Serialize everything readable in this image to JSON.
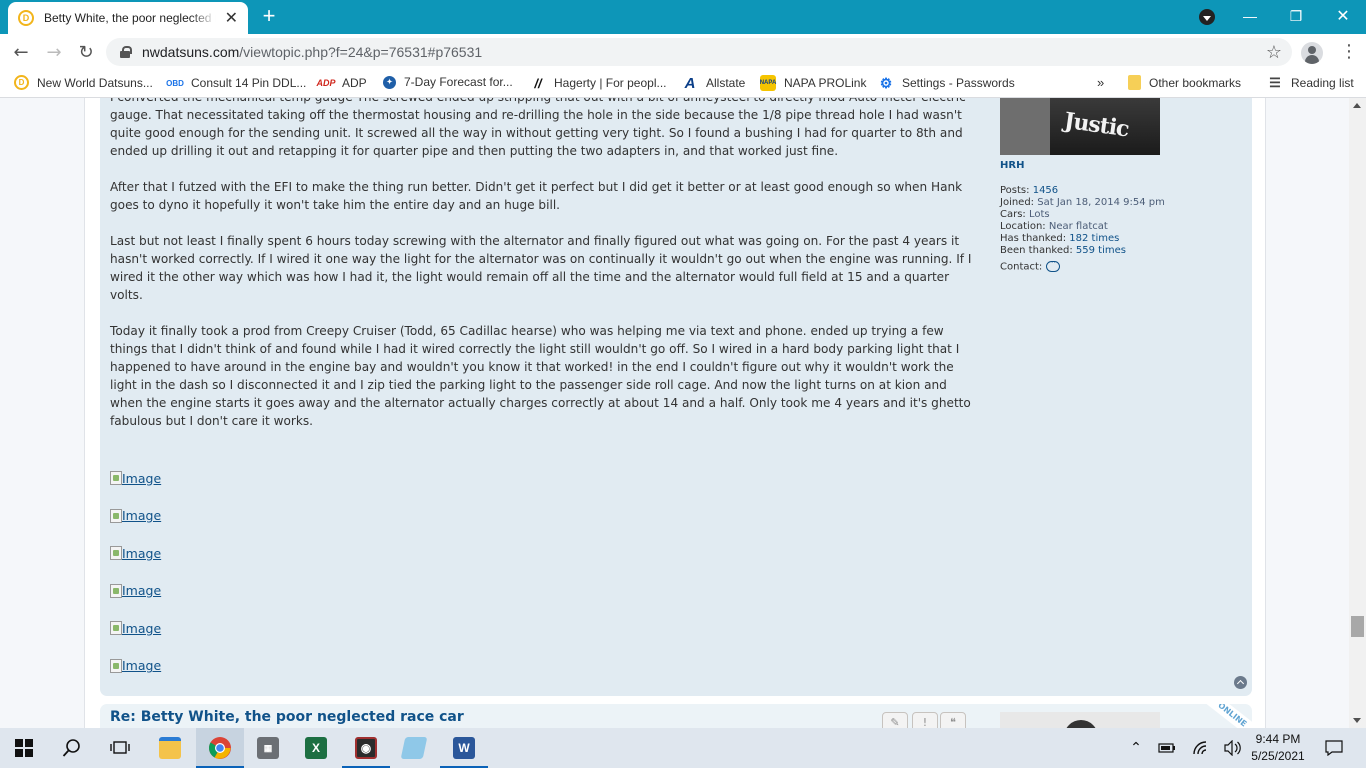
{
  "browser": {
    "tab_title": "Betty White, the poor neglected race car",
    "favicon_letter": "D",
    "url_host": "nwdatsuns.com",
    "url_path": "/viewtopic.php?f=24&p=76531#p76531"
  },
  "bookmarks": [
    {
      "label": "New World Datsuns...",
      "icon": "datsun-icon"
    },
    {
      "label": "Consult 14 Pin DDL...",
      "icon": "obd-icon"
    },
    {
      "label": "ADP",
      "icon": "adp-icon"
    },
    {
      "label": "7-Day Forecast for...",
      "icon": "noaa-icon"
    },
    {
      "label": "Hagerty | For peopl...",
      "icon": "hagerty-icon"
    },
    {
      "label": "Allstate",
      "icon": "allstate-icon"
    },
    {
      "label": "NAPA PROLink",
      "icon": "napa-icon"
    },
    {
      "label": "Settings - Passwords",
      "icon": "gear-icon"
    }
  ],
  "bookmarks_more": "»",
  "other_bookmarks": "Other bookmarks",
  "reading_list": "Reading list",
  "post": {
    "paragraphs": [
      "I converted the mechanical temp gauge The screwed ended up stripping that out with a bit of anneysteel to directly mod Auto meter electric gauge. That necessitated taking off the thermostat housing and re-drilling the hole in the side because the 1/8 pipe thread hole I had wasn't quite good enough for the sending unit. It screwed all the way in without getting very tight. So I found a bushing I had for quarter to 8th and ended up drilling it out and retapping it for quarter pipe and then putting the two adapters in, and that worked just fine.",
      "After that I futzed with the EFI to make the thing run better. Didn't get it perfect but I did get it better or at least good enough so when Hank goes to dyno it hopefully it won't take him the entire day and an huge bill.",
      "Last but not least I finally spent 6 hours today screwing with the alternator and finally figured out what was going on. For the past 4 years it hasn't worked correctly. If I wired it one way the light for the alternator was on continually it wouldn't go out when the engine was running. If I wired it the other way which was how I had it, the light would remain off all the time and the alternator would full field at 15 and a quarter volts.",
      "Today it finally took a prod from Creepy Cruiser (Todd, 65 Cadillac hearse) who was helping me via text and phone. ended up trying a few things that I didn't think of and found while I had it wired correctly the light still wouldn't go off. So I wired in a hard body parking light that I happened to have around in the engine bay and wouldn't you know it that worked! in the end I couldn't figure out why it wouldn't work the light in the dash so I disconnected it and I zip tied the parking light to the passenger side roll cage. And now the light turns on at kion and when the engine starts it goes away and the alternator actually charges correctly at about 14 and a half. Only took me 4 years and it's ghetto fabulous but I don't care it works."
    ],
    "image_alt": [
      "Image",
      "Image",
      "Image",
      "Image",
      "Image",
      "Image"
    ]
  },
  "profile": {
    "avatar_text": "Justic",
    "username": "HRH",
    "posts_label": "Posts:",
    "posts_value": "1456",
    "joined_label": "Joined:",
    "joined_value": "Sat Jan 18, 2014 9:54 pm",
    "cars_label": "Cars:",
    "cars_value": "Lots",
    "location_label": "Location:",
    "location_value": "Near flatcat",
    "thanked_label": "Has thanked:",
    "thanked_value": "182 times",
    "been_thanked_label": "Been thanked:",
    "been_thanked_value": "559 times",
    "contact_label": "Contact:"
  },
  "next_post": {
    "title": "Re: Betty White, the poor neglected race car",
    "edit_icon": "✎",
    "report_icon": "!",
    "quote_icon": "❝",
    "online_badge": "ONLINE"
  },
  "taskbar": {
    "time": "9:44 PM",
    "date": "5/25/2021",
    "apps": [
      "start-icon",
      "search-icon",
      "task-view-icon",
      "file-explorer-icon",
      "chrome-icon",
      "calculator-icon",
      "excel-icon",
      "eye-app-icon",
      "paint-icon",
      "word-icon"
    ]
  },
  "colors": {
    "chrome_frame": "#0d96b8",
    "post_bg": "#e1ebf2",
    "link": "#105289"
  }
}
